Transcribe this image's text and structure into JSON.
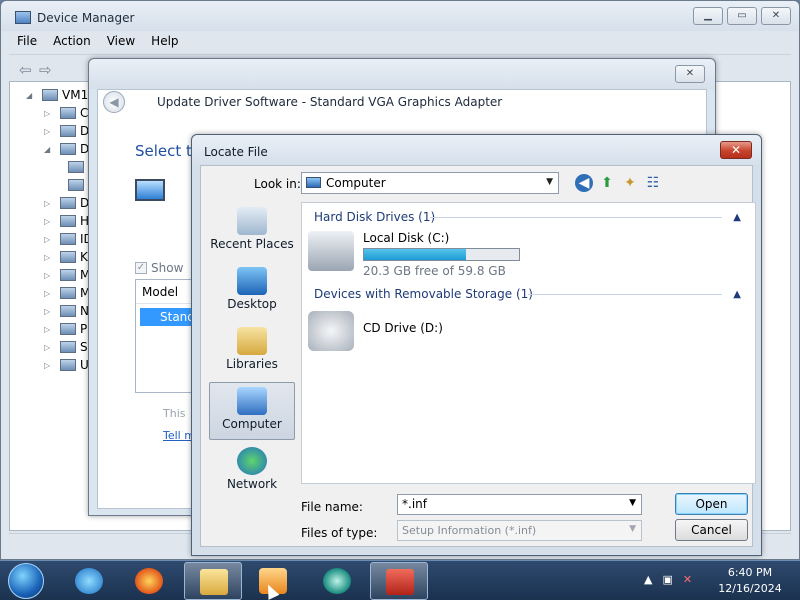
{
  "device_manager": {
    "title": "Device Manager",
    "menu": [
      "File",
      "Action",
      "View",
      "Help"
    ],
    "tree_root": "VM1",
    "tree_items": [
      "Co",
      "Di",
      "Di",
      "",
      "",
      "DV",
      "Hu",
      "ID",
      "Ke",
      "M",
      "M",
      "Ne",
      "Pr",
      "Sy",
      "Ur"
    ]
  },
  "wizard": {
    "title": "Update Driver Software - Standard VGA Graphics Adapter",
    "heading": "Select th",
    "show_label": "Show",
    "list_header": "Model",
    "list_selected": "Stand",
    "this_text": "This",
    "tell_link": "Tell m"
  },
  "locate": {
    "title": "Locate File",
    "close_glyph": "✕",
    "look_in_label": "Look in:",
    "look_in_value": "Computer",
    "places": [
      "Recent Places",
      "Desktop",
      "Libraries",
      "Computer",
      "Network"
    ],
    "groups": [
      {
        "label": "Hard Disk Drives (1)"
      },
      {
        "label": "Devices with Removable Storage (1)"
      }
    ],
    "drives": {
      "local": {
        "name": "Local Disk (C:)",
        "free_text": "20.3 GB free of 59.8 GB",
        "used_fraction": 0.66
      },
      "cd": {
        "name": "CD Drive (D:)"
      }
    },
    "file_name_label": "File name:",
    "file_name_value": "*.inf",
    "file_type_label": "Files of type:",
    "file_type_value": "Setup Information (*.inf)",
    "open_label": "Open",
    "cancel_label": "Cancel"
  },
  "taskbar": {
    "time": "6:40 PM",
    "date": "12/16/2024",
    "icons": [
      "start-orb",
      "ie-icon",
      "firefox-icon",
      "explorer-icon",
      "media-player-icon",
      "app-icon",
      "toolbox-icon"
    ]
  }
}
